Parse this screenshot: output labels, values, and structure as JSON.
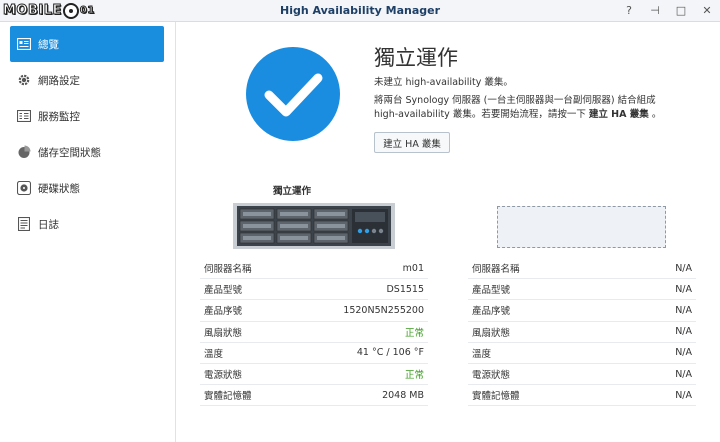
{
  "window": {
    "logo_text": "MOBILE",
    "logo_suffix": "01",
    "title": "High Availability Manager",
    "controls": [
      {
        "name": "help-button",
        "label": "?"
      },
      {
        "name": "pin-button",
        "label": "⊣"
      },
      {
        "name": "maximize-button",
        "label": "□"
      },
      {
        "name": "close-button",
        "label": "✕"
      }
    ]
  },
  "sidebar": {
    "items": [
      {
        "label": "總覽",
        "icon": "overview-icon",
        "active": true
      },
      {
        "label": "網路設定",
        "icon": "gear-icon",
        "active": false
      },
      {
        "label": "服務監控",
        "icon": "monitor-icon",
        "active": false
      },
      {
        "label": "儲存空間狀態",
        "icon": "pie-chart-icon",
        "active": false
      },
      {
        "label": "硬碟狀態",
        "icon": "disk-icon",
        "active": false
      },
      {
        "label": "日誌",
        "icon": "log-icon",
        "active": false
      }
    ]
  },
  "main": {
    "status_title": "獨立運作",
    "status_sub": "未建立 high-availability 叢集。",
    "desc_part1": "將兩台 Synology 伺服器 (一台主伺服器與一台副伺服器) 結合組成 high-availability 叢集。若要開始流程，請按一下",
    "desc_bold": "建立 HA 叢集",
    "desc_part2": "。",
    "create_button": "建立 HA 叢集",
    "server_label": "獨立運作",
    "left_table": [
      {
        "key": "伺服器名稱",
        "value": "m01",
        "status": false
      },
      {
        "key": "產品型號",
        "value": "DS1515",
        "status": false
      },
      {
        "key": "產品序號",
        "value": "1520N5N255200",
        "status": false
      },
      {
        "key": "風扇狀態",
        "value": "正常",
        "status": true
      },
      {
        "key": "溫度",
        "value": "41 °C / 106 °F",
        "status": false
      },
      {
        "key": "電源狀態",
        "value": "正常",
        "status": true
      },
      {
        "key": "實體記憶體",
        "value": "2048 MB",
        "status": false
      }
    ],
    "right_table": [
      {
        "key": "伺服器名稱",
        "value": "N/A"
      },
      {
        "key": "產品型號",
        "value": "N/A"
      },
      {
        "key": "產品序號",
        "value": "N/A"
      },
      {
        "key": "風扇狀態",
        "value": "N/A"
      },
      {
        "key": "溫度",
        "value": "N/A"
      },
      {
        "key": "電源狀態",
        "value": "N/A"
      },
      {
        "key": "實體記憶體",
        "value": "N/A"
      }
    ]
  },
  "colors": {
    "accent": "#198dde",
    "ok": "#3a9a1e",
    "title": "#1e3f66"
  }
}
